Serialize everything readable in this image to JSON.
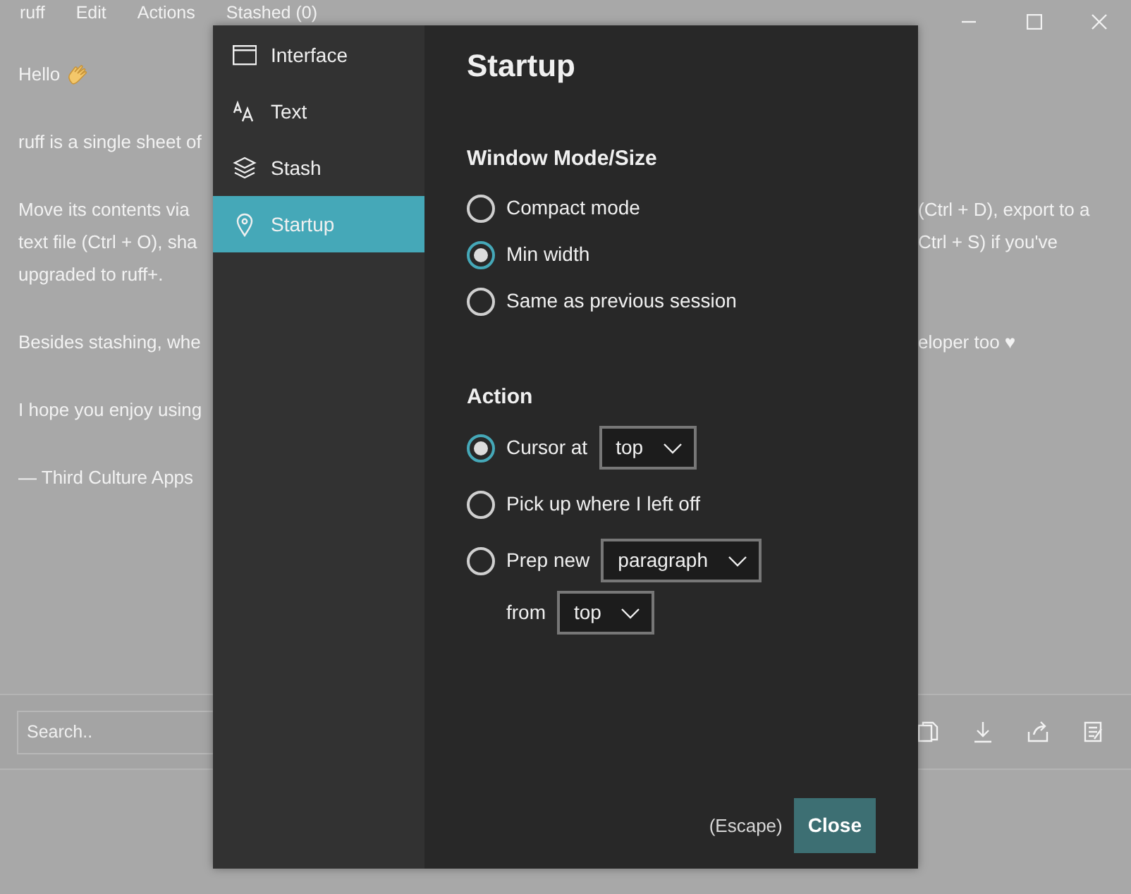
{
  "menu": [
    "ruff",
    "Edit",
    "Actions",
    "Stashed (0)"
  ],
  "document": {
    "paragraphs": [
      {
        "lines": [
          {
            "left": "Hello",
            "kind": "greeting"
          }
        ]
      },
      {
        "lines": [
          {
            "left": "ruff is a single sheet of"
          }
        ]
      },
      {
        "lines": [
          {
            "left": "Move its contents via",
            "right": "(Ctrl + D), export to a"
          },
          {
            "left": "text file (Ctrl + O), sha",
            "right": "Ctrl + S) if you've"
          },
          {
            "left": "upgraded to ruff+."
          }
        ]
      },
      {
        "lines": [
          {
            "left": "Besides stashing, whe",
            "right": "eloper too ♥"
          }
        ]
      },
      {
        "lines": [
          {
            "left": "I hope you enjoy using"
          }
        ]
      },
      {
        "lines": [
          {
            "left": "— Third Culture Apps"
          }
        ]
      }
    ]
  },
  "search": {
    "placeholder": "Search.."
  },
  "dialog": {
    "sidebar": [
      {
        "label": "Interface",
        "kind": "window",
        "selected": false
      },
      {
        "label": "Text",
        "kind": "text",
        "selected": false
      },
      {
        "label": "Stash",
        "kind": "layers",
        "selected": false
      },
      {
        "label": "Startup",
        "kind": "pin",
        "selected": true
      }
    ],
    "title": "Startup",
    "sections": [
      {
        "heading": "Window Mode/Size",
        "options": [
          {
            "label": "Compact mode",
            "selected": false
          },
          {
            "label": "Min width",
            "selected": true
          },
          {
            "label": "Same as previous session",
            "selected": false
          }
        ]
      },
      {
        "heading": "Action",
        "options": [
          {
            "label": "Cursor at",
            "selected": true,
            "dropdown": "top"
          },
          {
            "label": "Pick up where I left off",
            "selected": false
          },
          {
            "label": "Prep new",
            "selected": false,
            "dropdown": "paragraph",
            "sub": {
              "label": "from",
              "dropdown": "top"
            }
          }
        ]
      }
    ],
    "hint": "(Escape)",
    "close_button": "Close"
  }
}
